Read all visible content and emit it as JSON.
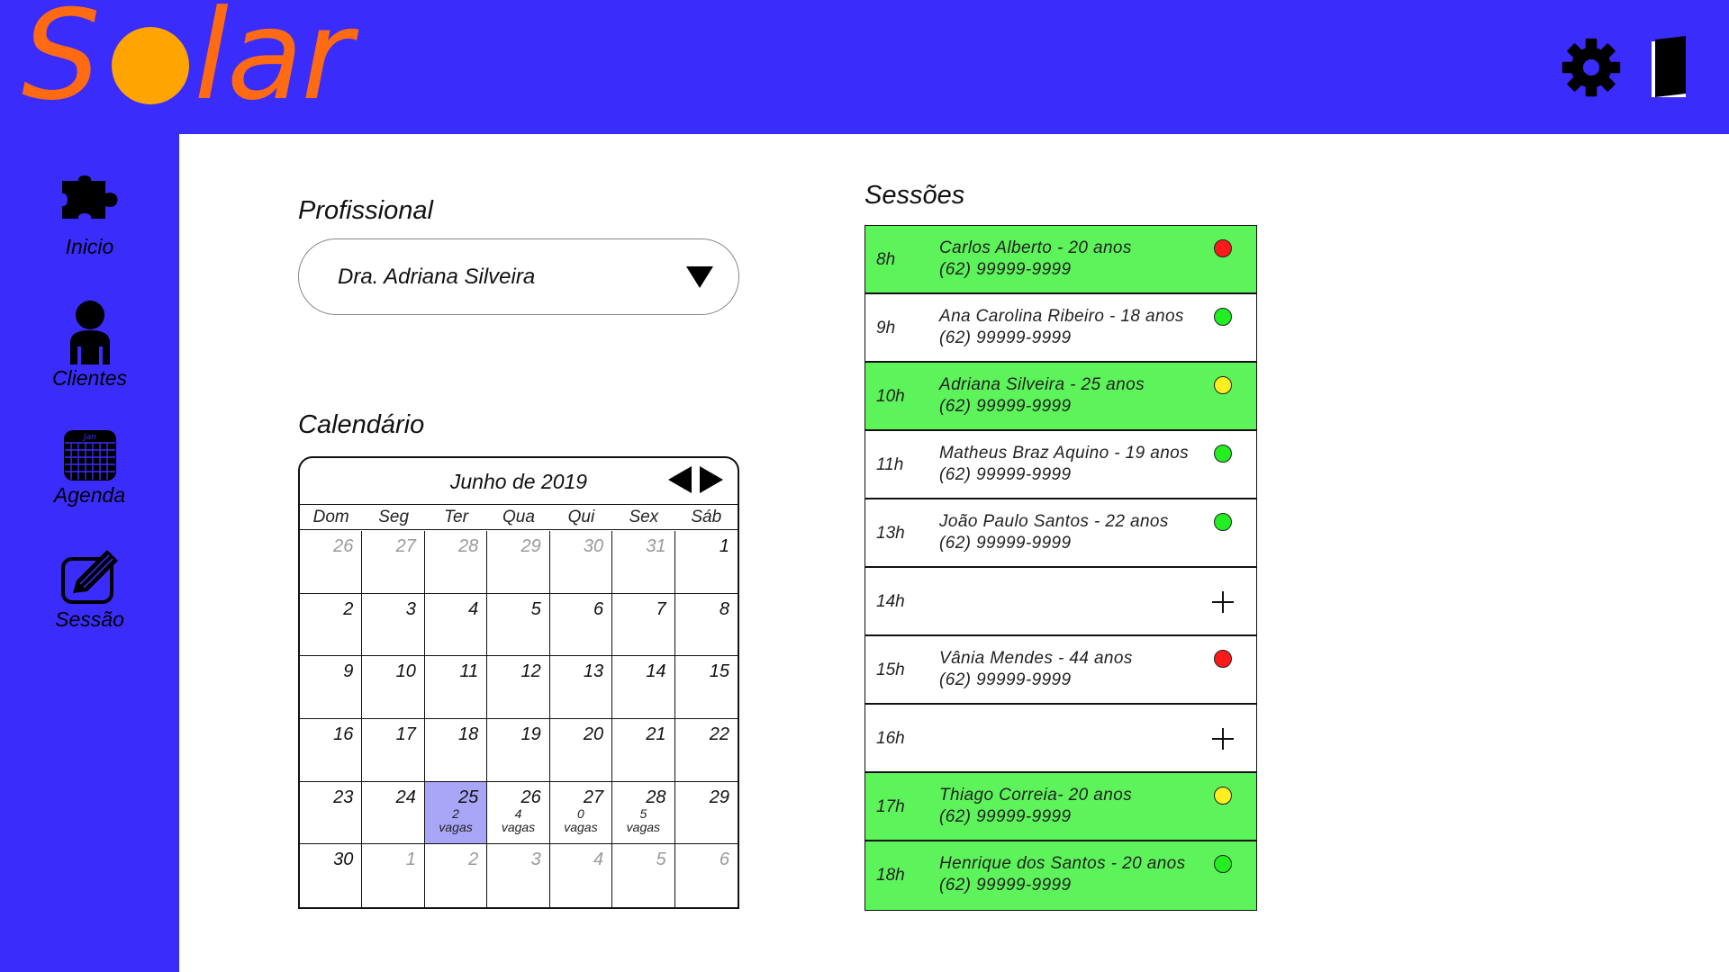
{
  "header": {
    "logo_text": "Solar",
    "colors": {
      "header_bg": "#3a2cfb",
      "logo_text": "#ff6a12",
      "logo_sun": "#ffa400"
    },
    "icons": [
      "gear-icon",
      "door-icon"
    ]
  },
  "sidebar": {
    "items": [
      {
        "label": "Inicio",
        "icon": "puzzle-icon"
      },
      {
        "label": "Clientes",
        "icon": "person-icon"
      },
      {
        "label": "Agenda",
        "icon": "calendar-icon",
        "icon_text": "Jan"
      },
      {
        "label": "Sessão",
        "icon": "edit-icon"
      }
    ]
  },
  "profissional": {
    "title": "Profissional",
    "selected": "Dra. Adriana Silveira"
  },
  "calendar": {
    "title": "Calendário",
    "month_label": "Junho de 2019",
    "weekdays": [
      "Dom",
      "Seg",
      "Ter",
      "Qua",
      "Qui",
      "Sex",
      "Sáb"
    ],
    "selected_color": "#a9a5f7",
    "days": [
      {
        "day": "26",
        "muted": true
      },
      {
        "day": "27",
        "muted": true
      },
      {
        "day": "28",
        "muted": true
      },
      {
        "day": "29",
        "muted": true
      },
      {
        "day": "30",
        "muted": true
      },
      {
        "day": "31",
        "muted": true
      },
      {
        "day": "1"
      },
      {
        "day": "2"
      },
      {
        "day": "3"
      },
      {
        "day": "4"
      },
      {
        "day": "5"
      },
      {
        "day": "6"
      },
      {
        "day": "7"
      },
      {
        "day": "8"
      },
      {
        "day": "9"
      },
      {
        "day": "10"
      },
      {
        "day": "11"
      },
      {
        "day": "12"
      },
      {
        "day": "13"
      },
      {
        "day": "14"
      },
      {
        "day": "15"
      },
      {
        "day": "16"
      },
      {
        "day": "17"
      },
      {
        "day": "18"
      },
      {
        "day": "19"
      },
      {
        "day": "20"
      },
      {
        "day": "21"
      },
      {
        "day": "22"
      },
      {
        "day": "23"
      },
      {
        "day": "24"
      },
      {
        "day": "25",
        "selected": true,
        "vagas_count": "2",
        "vagas_label": "vagas"
      },
      {
        "day": "26",
        "vagas_count": "4",
        "vagas_label": "vagas"
      },
      {
        "day": "27",
        "vagas_count": "0",
        "vagas_label": "vagas"
      },
      {
        "day": "28",
        "vagas_count": "5",
        "vagas_label": "vagas"
      },
      {
        "day": "29"
      },
      {
        "day": "30"
      },
      {
        "day": "1",
        "muted": true
      },
      {
        "day": "2",
        "muted": true
      },
      {
        "day": "3",
        "muted": true
      },
      {
        "day": "4",
        "muted": true
      },
      {
        "day": "5",
        "muted": true
      },
      {
        "day": "6",
        "muted": true
      }
    ]
  },
  "sessions": {
    "title": "Sessões",
    "colors": {
      "busy_bg": "#5df35a",
      "red": "#ff1a1a",
      "green": "#22ee22",
      "yellow": "#ffee22"
    },
    "slots": [
      {
        "time": "8h",
        "name": "Carlos Alberto - 20 anos",
        "phone": "(62) 99999-9999",
        "status": "red",
        "busy": true
      },
      {
        "time": "9h",
        "name": "Ana Carolina Ribeiro - 18 anos",
        "phone": "(62) 99999-9999",
        "status": "green",
        "busy": false
      },
      {
        "time": "10h",
        "name": "Adriana Silveira - 25 anos",
        "phone": "(62) 99999-9999",
        "status": "yellow",
        "busy": true
      },
      {
        "time": "11h",
        "name": "Matheus Braz Aquino - 19 anos",
        "phone": "(62) 99999-9999",
        "status": "green",
        "busy": false
      },
      {
        "time": "13h",
        "name": "João Paulo Santos - 22 anos",
        "phone": "(62) 99999-9999",
        "status": "green",
        "busy": false
      },
      {
        "time": "14h",
        "empty": true
      },
      {
        "time": "15h",
        "name": "Vânia Mendes - 44 anos",
        "phone": "(62) 99999-9999",
        "status": "red",
        "busy": false
      },
      {
        "time": "16h",
        "empty": true
      },
      {
        "time": "17h",
        "name": "Thiago Correia- 20 anos",
        "phone": "(62) 99999-9999",
        "status": "yellow",
        "busy": true
      },
      {
        "time": "18h",
        "name": "Henrique dos Santos - 20 anos",
        "phone": "(62) 99999-9999",
        "status": "green",
        "busy": true
      }
    ]
  }
}
